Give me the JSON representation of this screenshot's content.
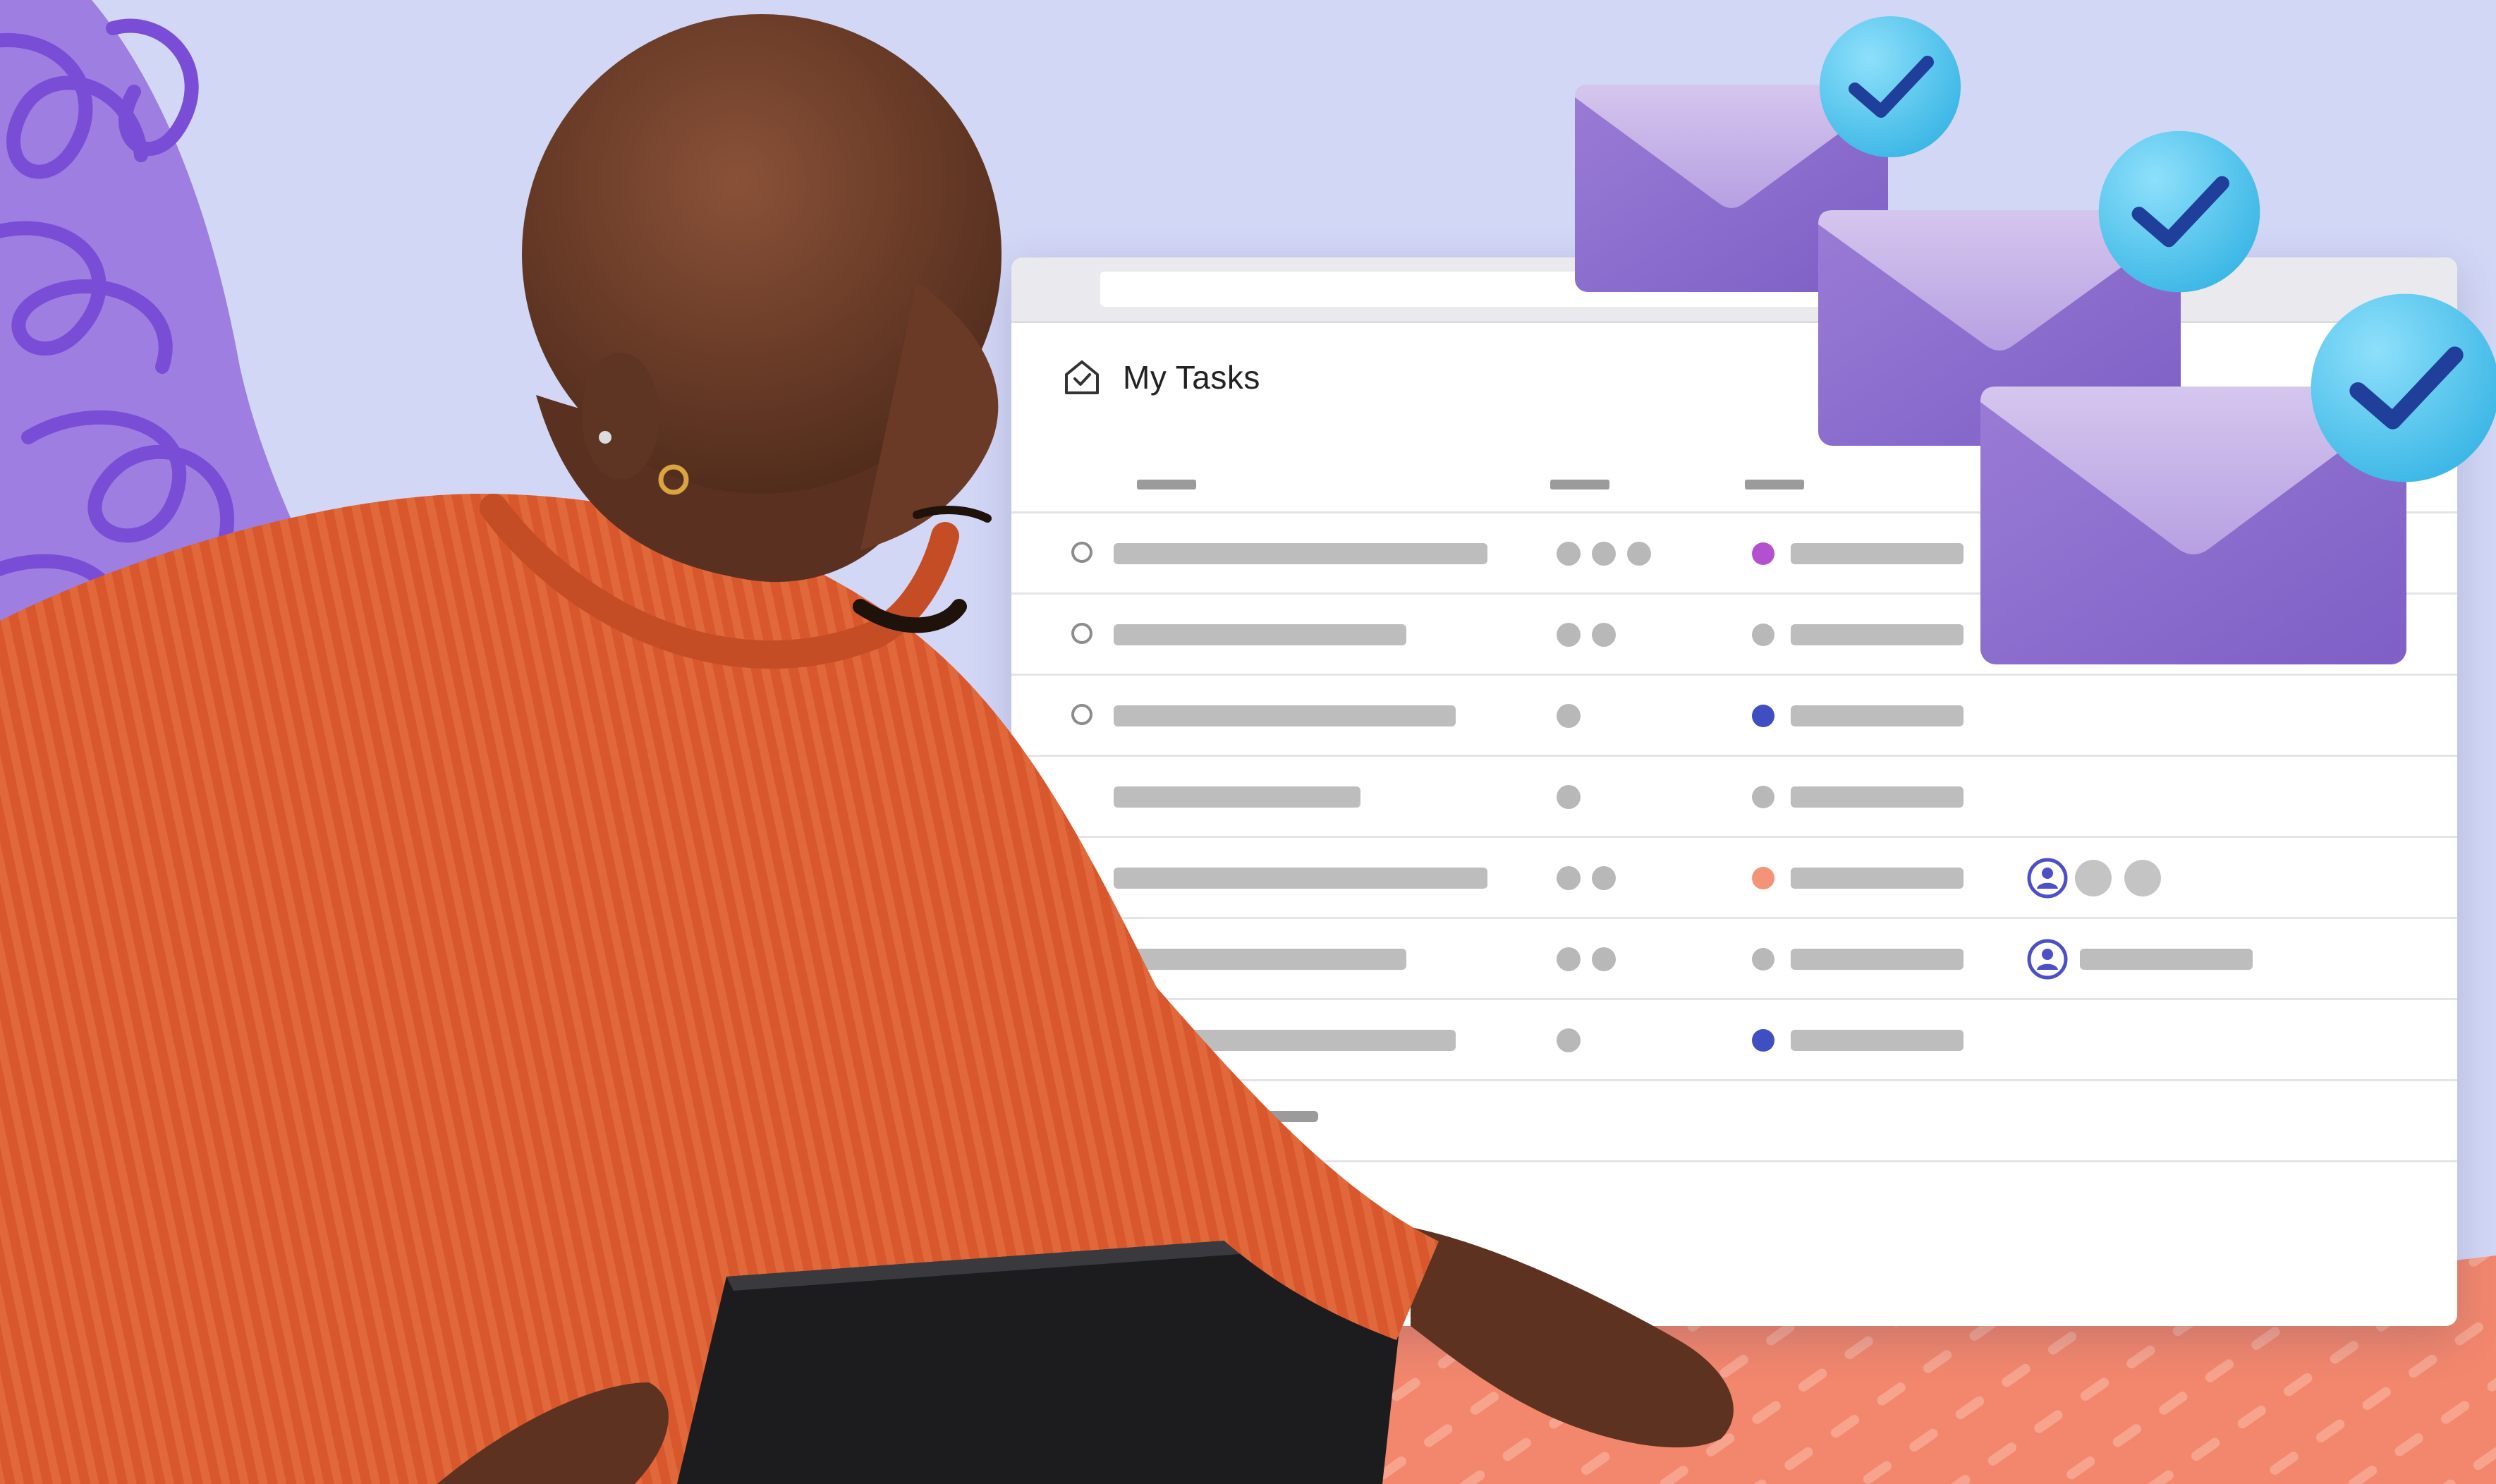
{
  "app": {
    "page_title": "My Tasks",
    "icon": "home-check-icon"
  },
  "task_table": {
    "rows": [
      {
        "status_color": "#b44fd0",
        "open": true
      },
      {
        "status_color": "#b8b8b8",
        "open": true
      },
      {
        "status_color": "#3f4ec0",
        "open": true
      },
      {
        "status_color": "#b8b8b8",
        "open": false
      },
      {
        "status_color": "#f39478",
        "open": false
      },
      {
        "status_color": "#b8b8b8",
        "open": false
      },
      {
        "status_color": "#3f4ec0",
        "open": false
      }
    ]
  },
  "colors": {
    "background": "#d3d7f6",
    "accent_purple": "#8257d8",
    "accent_coral": "#f2876d",
    "check_blue": "#53c4ec",
    "envelope": "#a98ad8"
  }
}
